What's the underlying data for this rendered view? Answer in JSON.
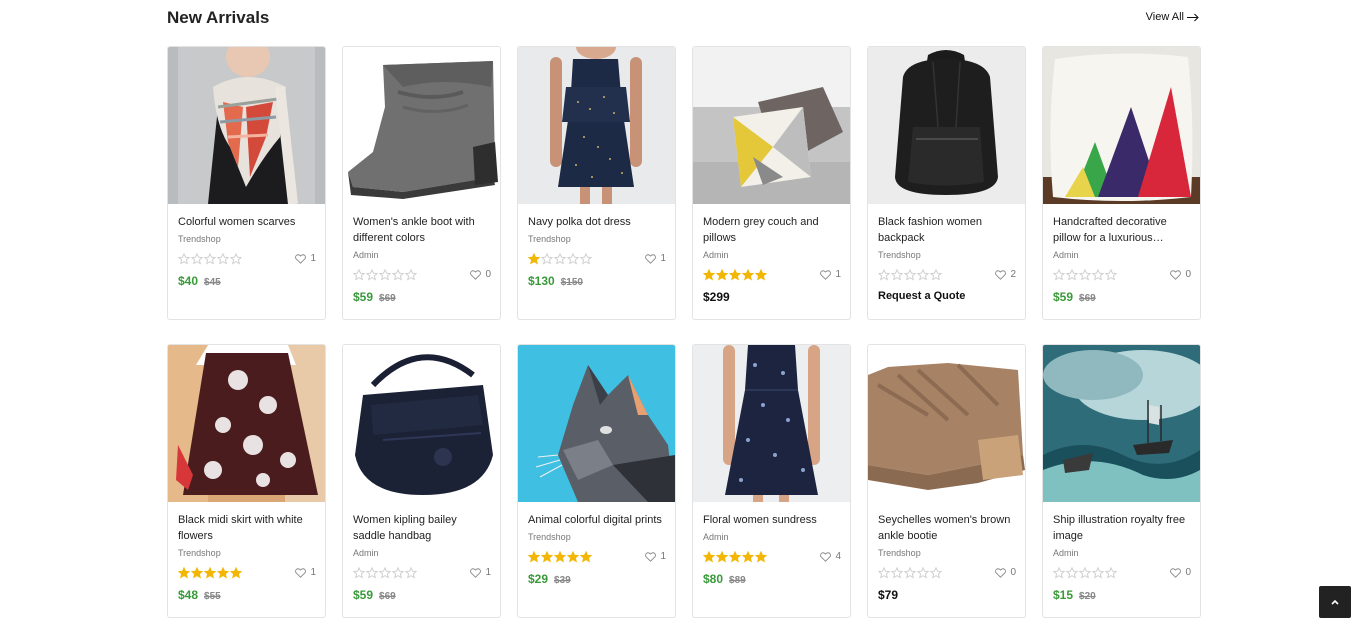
{
  "section": {
    "title": "New Arrivals",
    "view_all": "View All"
  },
  "colors": {
    "price_green": "#3a9a3a",
    "star_gold": "#f2b705",
    "star_empty": "#cccccc"
  },
  "products": [
    {
      "title": "Colorful women scarves",
      "seller": "Trendshop",
      "rating": 0,
      "likes": "1",
      "price": "$40",
      "old_price": "$45",
      "image": "scarf-image"
    },
    {
      "title": "Women's ankle boot with different colors",
      "seller": "Admin",
      "rating": 0,
      "likes": "0",
      "price": "$59",
      "old_price": "$69",
      "image": "boot-image"
    },
    {
      "title": "Navy polka dot dress",
      "seller": "Trendshop",
      "rating": 1,
      "likes": "1",
      "price": "$130",
      "old_price": "$150",
      "image": "dress-image"
    },
    {
      "title": "Modern grey couch and pillows",
      "seller": "Admin",
      "rating": 5,
      "likes": "1",
      "price": "$299",
      "old_price": "",
      "image": "couch-image"
    },
    {
      "title": "Black fashion women backpack",
      "seller": "Trendshop",
      "rating": 0,
      "likes": "2",
      "price": "",
      "old_price": "",
      "quote": "Request a Quote",
      "image": "backpack-image"
    },
    {
      "title": "Handcrafted decorative pillow for a luxurious…",
      "seller": "Admin",
      "rating": 0,
      "likes": "0",
      "price": "$59",
      "old_price": "$69",
      "image": "pillow-image"
    },
    {
      "title": "Black midi skirt with white flowers",
      "seller": "Trendshop",
      "rating": 5,
      "likes": "1",
      "price": "$48",
      "old_price": "$55",
      "image": "skirt-image"
    },
    {
      "title": "Women kipling bailey saddle handbag",
      "seller": "Admin",
      "rating": 0,
      "likes": "1",
      "price": "$59",
      "old_price": "$69",
      "image": "handbag-image"
    },
    {
      "title": "Animal colorful digital prints",
      "seller": "Trendshop",
      "rating": 5,
      "likes": "1",
      "price": "$29",
      "old_price": "$39",
      "image": "cat-print-image"
    },
    {
      "title": "Floral women sundress",
      "seller": "Admin",
      "rating": 5,
      "likes": "4",
      "price": "$80",
      "old_price": "$89",
      "image": "sundress-image"
    },
    {
      "title": "Seychelles women's brown ankle bootie",
      "seller": "Trendshop",
      "rating": 0,
      "likes": "0",
      "price": "$79",
      "old_price": "",
      "image": "bootie-image"
    },
    {
      "title": "Ship illustration royalty free image",
      "seller": "Admin",
      "rating": 0,
      "likes": "0",
      "price": "$15",
      "old_price": "$20",
      "image": "ship-image"
    }
  ]
}
